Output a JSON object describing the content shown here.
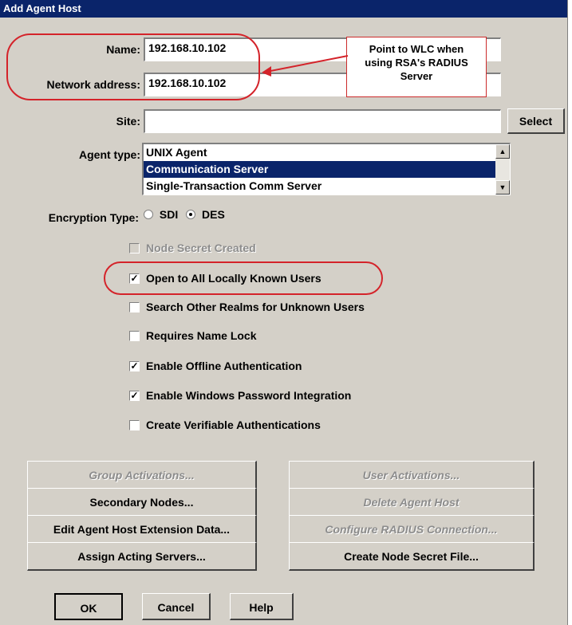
{
  "window": {
    "title": "Add Agent Host"
  },
  "form": {
    "name_label": "Name:",
    "name_value": "192.168.10.102",
    "netaddr_label": "Network address:",
    "netaddr_value": "192.168.10.102",
    "site_label": "Site:",
    "site_value": "",
    "select_label": "Select",
    "agent_type_label": "Agent type:",
    "agent_types": [
      "UNIX Agent",
      "Communication Server",
      "Single-Transaction Comm Server"
    ],
    "agent_type_selected": "Communication Server",
    "encryption_label": "Encryption Type:",
    "enc_sdi": "SDI",
    "enc_des": "DES",
    "enc_selected": "DES"
  },
  "annotation": {
    "callout_line1": "Point to WLC when",
    "callout_line2": "using RSA's RADIUS",
    "callout_line3": "Server",
    "color": "#d4232a"
  },
  "checkboxes": [
    {
      "label": "Node Secret Created",
      "checked": false,
      "disabled": true
    },
    {
      "label": "Open to All Locally Known Users",
      "checked": true,
      "disabled": false
    },
    {
      "label": "Search Other Realms for Unknown Users",
      "checked": false,
      "disabled": false
    },
    {
      "label": "Requires Name Lock",
      "checked": false,
      "disabled": false
    },
    {
      "label": "Enable Offline Authentication",
      "checked": true,
      "disabled": false
    },
    {
      "label": "Enable Windows Password Integration",
      "checked": true,
      "disabled": false
    },
    {
      "label": "Create Verifiable Authentications",
      "checked": false,
      "disabled": false
    }
  ],
  "buttons": {
    "group_activations": "Group Activations...",
    "user_activations": "User Activations...",
    "secondary_nodes": "Secondary Nodes...",
    "delete_agent_host": "Delete Agent Host",
    "edit_extension": "Edit Agent Host Extension Data...",
    "configure_radius": "Configure RADIUS Connection...",
    "assign_servers": "Assign Acting Servers...",
    "create_node_secret": "Create Node Secret File...",
    "ok": "OK",
    "cancel": "Cancel",
    "help": "Help"
  },
  "icons": {
    "scroll_up": "scroll-up-arrow-icon",
    "scroll_down": "scroll-down-arrow-icon",
    "check": "checkmark-icon"
  }
}
